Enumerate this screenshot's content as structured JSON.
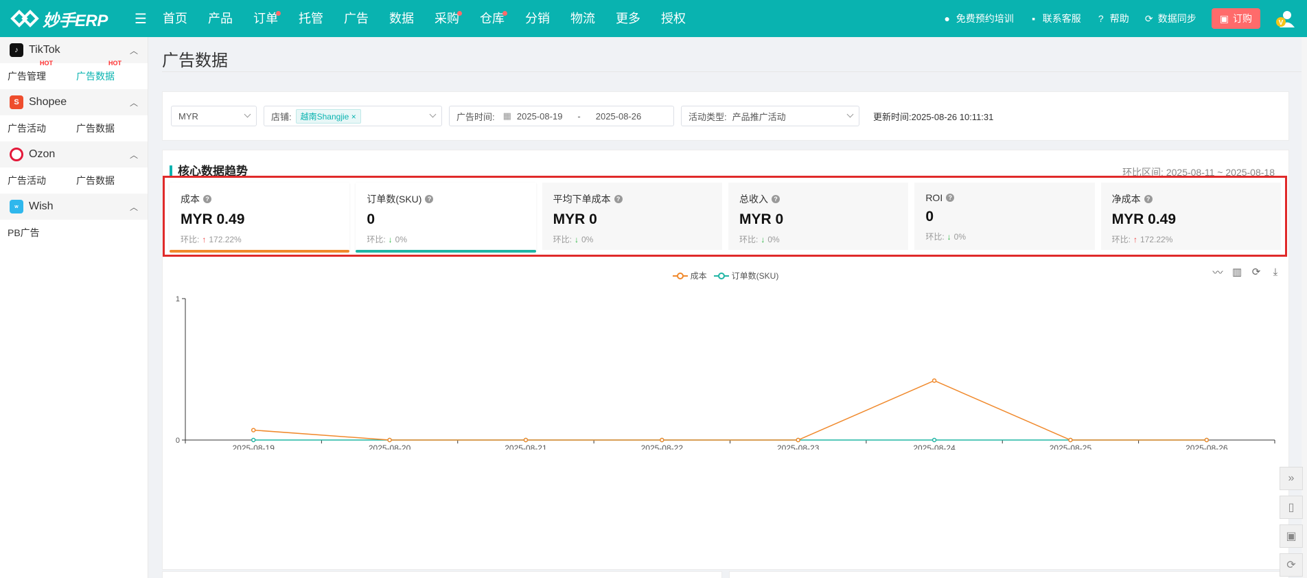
{
  "app": {
    "logo_text": "妙手ERP"
  },
  "nav": {
    "items": [
      {
        "label": "首页",
        "dot": false
      },
      {
        "label": "产品",
        "dot": false
      },
      {
        "label": "订单",
        "dot": true
      },
      {
        "label": "托管",
        "dot": false
      },
      {
        "label": "广告",
        "dot": false
      },
      {
        "label": "数据",
        "dot": false
      },
      {
        "label": "采购",
        "dot": true
      },
      {
        "label": "仓库",
        "dot": true
      },
      {
        "label": "分销",
        "dot": false
      },
      {
        "label": "物流",
        "dot": false
      },
      {
        "label": "更多",
        "dot": false
      },
      {
        "label": "授权",
        "dot": false
      }
    ]
  },
  "topright": {
    "training": "免费预约培训",
    "support": "联系客服",
    "help": "帮助",
    "sync": "数据同步",
    "buy": "订购"
  },
  "sidebar": {
    "groups": [
      {
        "name": "TikTok",
        "links": [
          "广告管理",
          "广告数据"
        ],
        "hot": [
          "HOT",
          "HOT"
        ]
      },
      {
        "name": "Shopee",
        "links": [
          "广告活动",
          "广告数据"
        ]
      },
      {
        "name": "Ozon",
        "links": [
          "广告活动",
          "广告数据"
        ]
      },
      {
        "name": "Wish",
        "links": [
          "PB广告"
        ]
      }
    ]
  },
  "page": {
    "title": "广告数据"
  },
  "filters": {
    "currency": "MYR",
    "shop_label": "店铺:",
    "shop_tag": "越南Shangjie",
    "time_label": "广告时间:",
    "date_from": "2025-08-19",
    "date_sep": "-",
    "date_to": "2025-08-26",
    "type_label": "活动类型:",
    "type_value": "产品推广活动",
    "update_label": "更新时间:",
    "update_value": "2025-08-26 10:11:31"
  },
  "core": {
    "title": "核心数据趋势",
    "compare_label": "环比区间:",
    "compare_range": "2025-08-11 ~ 2025-08-18",
    "cmp_prefix": "环比:",
    "kpis": [
      {
        "label": "成本",
        "value": "MYR 0.49",
        "change": "172.22%",
        "dir": "up",
        "bar": "#f0892c"
      },
      {
        "label": "订单数(SKU)",
        "value": "0",
        "change": "0%",
        "dir": "down",
        "bar": "#1fb5a4"
      },
      {
        "label": "平均下单成本",
        "value": "MYR 0",
        "change": "0%",
        "dir": "down",
        "bar": ""
      },
      {
        "label": "总收入",
        "value": "MYR 0",
        "change": "0%",
        "dir": "down",
        "bar": ""
      },
      {
        "label": "ROI",
        "value": "0",
        "change": "0%",
        "dir": "down",
        "bar": ""
      },
      {
        "label": "净成本",
        "value": "MYR 0.49",
        "change": "172.22%",
        "dir": "up",
        "bar": ""
      }
    ]
  },
  "chart_data": {
    "type": "line",
    "x": [
      "2025-08-19",
      "2025-08-20",
      "2025-08-21",
      "2025-08-22",
      "2025-08-23",
      "2025-08-24",
      "2025-08-25",
      "2025-08-26"
    ],
    "series": [
      {
        "name": "成本",
        "color": "#f0892c",
        "values": [
          0.07,
          0,
          0,
          0,
          0,
          0.42,
          0,
          0
        ]
      },
      {
        "name": "订单数(SKU)",
        "color": "#1fb5a4",
        "values": [
          0,
          0,
          0,
          0,
          0,
          0,
          0,
          0
        ]
      }
    ],
    "yticks": [
      "0",
      "1"
    ],
    "ylim": [
      0,
      1
    ]
  }
}
